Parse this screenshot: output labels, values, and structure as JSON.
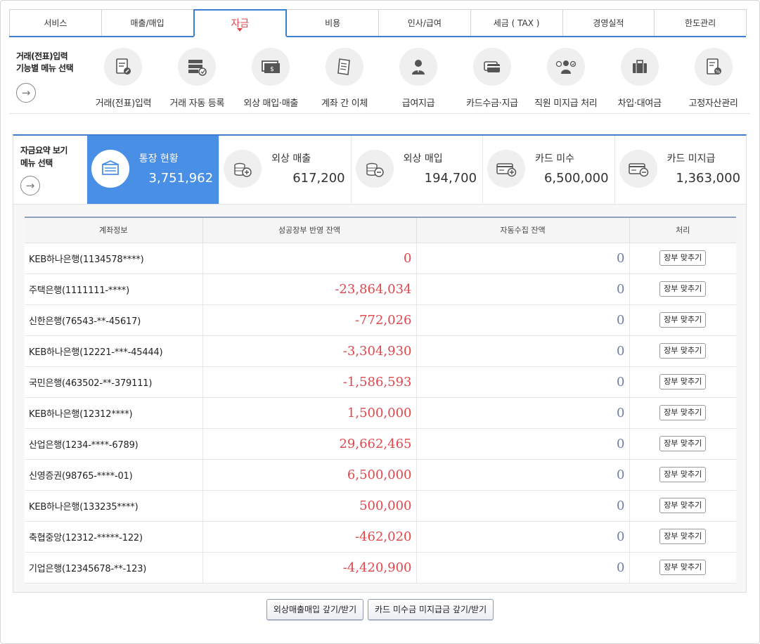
{
  "tabs": [
    {
      "label": "서비스",
      "active": false
    },
    {
      "label": "매출/매입",
      "active": false
    },
    {
      "label": "자금",
      "active": true
    },
    {
      "label": "비용",
      "active": false
    },
    {
      "label": "인사/급여",
      "active": false
    },
    {
      "label": "세금 ( TAX )",
      "active": false
    },
    {
      "label": "경영실적",
      "active": false
    },
    {
      "label": "한도관리",
      "active": false
    }
  ],
  "menu": {
    "caption_line1": "거래(전표)입력",
    "caption_line2": "기능별 메뉴 선택",
    "items": [
      {
        "label": "거래(전표)입력",
        "icon": "document-pen-icon"
      },
      {
        "label": "거래 자동 등록",
        "icon": "server-auto-icon"
      },
      {
        "label": "외상 매입·매출",
        "icon": "cash-register-icon"
      },
      {
        "label": "계좌 간 이체",
        "icon": "receipt-icon"
      },
      {
        "label": "급여지급",
        "icon": "person-icon"
      },
      {
        "label": "카드수금·지급",
        "icon": "credit-card-icon"
      },
      {
        "label": "직원 미지급 처리",
        "icon": "employee-payment-icon"
      },
      {
        "label": "차입·대여금",
        "icon": "briefcase-icon"
      },
      {
        "label": "고정자산관리",
        "icon": "asset-document-icon"
      }
    ]
  },
  "summary": {
    "caption_line1": "자금요약 보기",
    "caption_line2": "메뉴 선택",
    "cards": [
      {
        "label": "통장 현황",
        "value": "3,751,962",
        "icon": "bankbook-icon",
        "active": true
      },
      {
        "label": "외상 매출",
        "value": "617,200",
        "icon": "coins-plus-icon",
        "active": false
      },
      {
        "label": "외상 매입",
        "value": "194,700",
        "icon": "coins-minus-icon",
        "active": false
      },
      {
        "label": "카드 미수",
        "value": "6,500,000",
        "icon": "card-plus-icon",
        "active": false
      },
      {
        "label": "카드 미지급",
        "value": "1,363,000",
        "icon": "card-minus-icon",
        "active": false
      }
    ]
  },
  "table": {
    "headers": [
      "계좌정보",
      "성공장부 반영 잔액",
      "자동수집 잔액",
      "처리"
    ],
    "action_label": "장부 맞추기",
    "rows": [
      {
        "account": "KEB하나은행(1134578****)",
        "ledger": "0",
        "auto": "0"
      },
      {
        "account": "주택은행(1111111-****)",
        "ledger": "-23,864,034",
        "auto": "0"
      },
      {
        "account": "신한은행(76543-**-45617)",
        "ledger": "-772,026",
        "auto": "0"
      },
      {
        "account": "KEB하나은행(12221-***-45444)",
        "ledger": "-3,304,930",
        "auto": "0"
      },
      {
        "account": "국민은행(463502-**-379111)",
        "ledger": "-1,586,593",
        "auto": "0"
      },
      {
        "account": "KEB하나은행(12312****)",
        "ledger": "1,500,000",
        "auto": "0"
      },
      {
        "account": "산업은행(1234-****-6789)",
        "ledger": "29,662,465",
        "auto": "0"
      },
      {
        "account": "신영증권(98765-****-01)",
        "ledger": "6,500,000",
        "auto": "0"
      },
      {
        "account": "KEB하나은행(133235****)",
        "ledger": "500,000",
        "auto": "0"
      },
      {
        "account": "축협중앙(12312-*****-122)",
        "ledger": "-462,020",
        "auto": "0"
      },
      {
        "account": "기업은행(12345678-**-123)",
        "ledger": "-4,420,900",
        "auto": "0"
      }
    ]
  },
  "buttons": {
    "receivable_payable": "외상매출매입 갚기/받기",
    "card_receivable_payable": "카드 미수금 미지급금 갚기/받기"
  },
  "colors": {
    "accent_blue": "#3d7fcf",
    "active_card": "#4a8fe6",
    "negative_red": "#e0474c",
    "auto_value": "#6f7fa6"
  }
}
